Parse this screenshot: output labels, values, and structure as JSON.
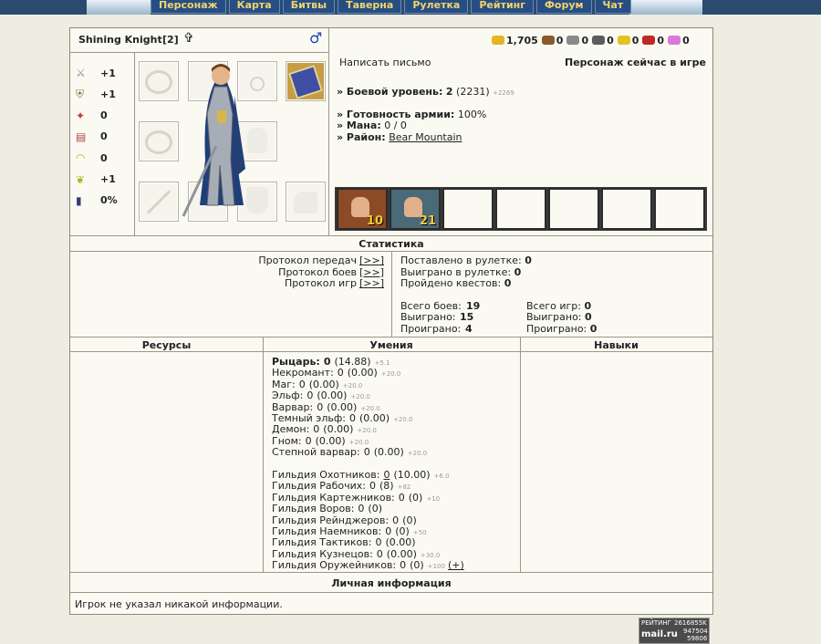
{
  "nav": [
    "Персонаж",
    "Карта",
    "Битвы",
    "Таверна",
    "Рулетка",
    "Рейтинг",
    "Форум",
    "Чат"
  ],
  "character": {
    "name": "Shining Knight",
    "level_bracket": "[2]",
    "write_letter": "Написать письмо",
    "online_status": "Персонаж сейчас в игре"
  },
  "resources_bar": [
    {
      "icon": "gold-icon",
      "value": "1,705"
    },
    {
      "icon": "wood-icon",
      "value": "0"
    },
    {
      "icon": "ore-icon",
      "value": "0"
    },
    {
      "icon": "mercury-icon",
      "value": "0"
    },
    {
      "icon": "sulfur-icon",
      "value": "0"
    },
    {
      "icon": "crystal-icon",
      "value": "0"
    },
    {
      "icon": "gems-icon",
      "value": "0"
    }
  ],
  "stats": [
    {
      "icon": "attack-icon",
      "value": "+1"
    },
    {
      "icon": "defense-icon",
      "value": "+1"
    },
    {
      "icon": "spellpower-icon",
      "value": "0"
    },
    {
      "icon": "knowledge-icon",
      "value": "0"
    },
    {
      "icon": "luck-icon",
      "value": "0"
    },
    {
      "icon": "morale-icon",
      "value": "+1"
    },
    {
      "icon": "initiative-icon",
      "value": "0%"
    }
  ],
  "info": {
    "combat_level_label": "» Боевой уровень:",
    "combat_level": "2",
    "combat_exp": "(2231)",
    "combat_exp_next": "+2269",
    "army_ready_label": "» Готовность армии:",
    "army_ready": "100%",
    "mana_label": "» Мана:",
    "mana": "0 / 0",
    "district_label": "» Район:",
    "district": "Bear Mountain"
  },
  "army": [
    {
      "name": "unit-1",
      "count": "10"
    },
    {
      "name": "unit-2",
      "count": "21"
    }
  ],
  "statistics": {
    "title": "Статистика",
    "protocols": [
      "Протокол передач",
      "Протокол боев",
      "Протокол игр"
    ],
    "protocol_link": "[>>]",
    "roulette_bet_label": "Поставлено в рулетке:",
    "roulette_bet": "0",
    "roulette_won_label": "Выиграно в рулетке:",
    "roulette_won": "0",
    "quests_label": "Пройдено квестов:",
    "quests": "0",
    "battles_total_label": "Всего боев:",
    "battles_total": "19",
    "battles_won_label": "Выиграно:",
    "battles_won": "15",
    "battles_lost_label": "Проиграно:",
    "battles_lost": "4",
    "games_total_label": "Всего игр:",
    "games_total": "0",
    "games_won_label": "Выиграно:",
    "games_won": "0",
    "games_lost_label": "Проиграно:",
    "games_lost": "0"
  },
  "columns": {
    "resources": "Ресурсы",
    "skills": "Умения",
    "abilities": "Навыки"
  },
  "skills_faction": [
    {
      "name": "Рыцарь:",
      "val": "0",
      "pts": "(14.88)",
      "next": "+5.1",
      "bold": true
    },
    {
      "name": "Некромант:",
      "val": "0",
      "pts": "(0.00)",
      "next": "+20.0"
    },
    {
      "name": "Маг:",
      "val": "0",
      "pts": "(0.00)",
      "next": "+20.0"
    },
    {
      "name": "Эльф:",
      "val": "0",
      "pts": "(0.00)",
      "next": "+20.0"
    },
    {
      "name": "Варвар:",
      "val": "0",
      "pts": "(0.00)",
      "next": "+20.0"
    },
    {
      "name": "Темный эльф:",
      "val": "0",
      "pts": "(0.00)",
      "next": "+20.0"
    },
    {
      "name": "Демон:",
      "val": "0",
      "pts": "(0.00)",
      "next": "+20.0"
    },
    {
      "name": "Гном:",
      "val": "0",
      "pts": "(0.00)",
      "next": "+20.0"
    },
    {
      "name": "Степной варвар:",
      "val": "0",
      "pts": "(0.00)",
      "next": "+20.0"
    }
  ],
  "skills_guild": [
    {
      "name": "Гильдия Охотников:",
      "val": "0",
      "pts": "(10.00)",
      "next": "+6.0",
      "underline": true
    },
    {
      "name": "Гильдия Рабочих:",
      "val": "0",
      "pts": "(8)",
      "next": "+82"
    },
    {
      "name": "Гильдия Картежников:",
      "val": "0",
      "pts": "(0)",
      "next": "+10"
    },
    {
      "name": "Гильдия Воров:",
      "val": "0",
      "pts": "(0)",
      "next": ""
    },
    {
      "name": "Гильдия Рейнджеров:",
      "val": "0",
      "pts": "(0)",
      "next": ""
    },
    {
      "name": "Гильдия Наемников:",
      "val": "0",
      "pts": "(0)",
      "next": "+50"
    },
    {
      "name": "Гильдия Тактиков:",
      "val": "0",
      "pts": "(0.00)",
      "next": ""
    },
    {
      "name": "Гильдия Кузнецов:",
      "val": "0",
      "pts": "(0.00)",
      "next": "+30.0"
    },
    {
      "name": "Гильдия Оружейников:",
      "val": "0",
      "pts": "(0)",
      "next": "+100",
      "extra": "(+)"
    }
  ],
  "personal": {
    "title": "Личная информация",
    "text": "Игрок не указал никакой информации."
  },
  "counter": {
    "line1": "РЕЙТИНГ",
    "line1b": "2616855K",
    "brand": "mail.ru",
    "n1": "947504",
    "n2": "59806"
  }
}
